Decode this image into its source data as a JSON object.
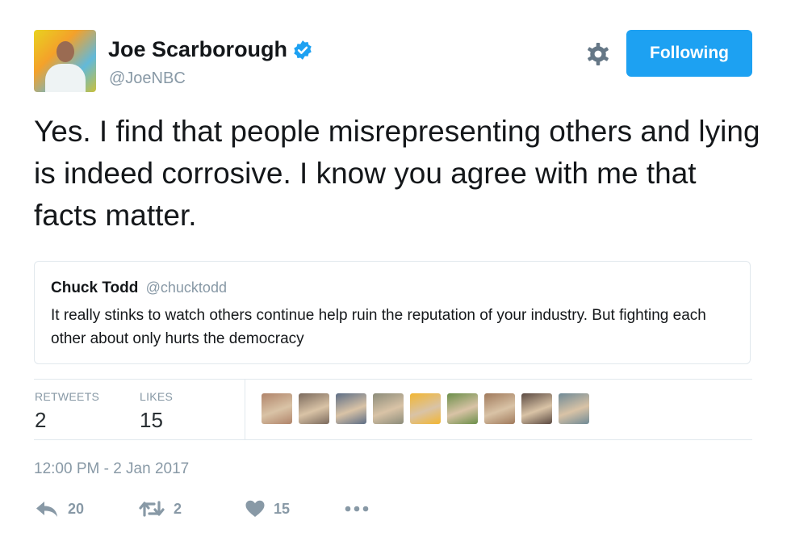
{
  "author": {
    "name": "Joe Scarborough",
    "handle": "@JoeNBC",
    "avatar_icon": "profile-photo",
    "verified_icon": "verified-badge-icon"
  },
  "header": {
    "settings_icon": "gear-icon",
    "follow_button_label": "Following"
  },
  "tweet": {
    "text": "Yes. I find that people misrepresenting others and lying is indeed corrosive. I know you agree with me that facts matter."
  },
  "quoted_tweet": {
    "author_name": "Chuck Todd",
    "author_handle": "@chucktodd",
    "text": "It really stinks to watch others continue help ruin the reputation of your industry. But fighting each other about only hurts the democracy"
  },
  "stats": {
    "retweets_label": "RETWEETS",
    "retweets_value": "2",
    "likes_label": "LIKES",
    "likes_value": "15"
  },
  "likers": [
    {
      "icon": "liker-avatar",
      "color": "#b0846a"
    },
    {
      "icon": "liker-avatar",
      "color": "#7b6a5d"
    },
    {
      "icon": "liker-avatar",
      "color": "#5d6e86"
    },
    {
      "icon": "liker-avatar",
      "color": "#8c8c7a"
    },
    {
      "icon": "liker-avatar",
      "color": "#f2b632"
    },
    {
      "icon": "liker-avatar",
      "color": "#6b8f4a"
    },
    {
      "icon": "liker-avatar",
      "color": "#a07a5c"
    },
    {
      "icon": "liker-avatar",
      "color": "#5b4a42"
    },
    {
      "icon": "liker-avatar",
      "color": "#6f8a96"
    }
  ],
  "timestamp": "12:00 PM - 2 Jan 2017",
  "actions": {
    "reply_icon": "reply-icon",
    "reply_count": "20",
    "retweet_icon": "retweet-icon",
    "retweet_count": "2",
    "like_icon": "heart-icon",
    "like_count": "15",
    "more_icon": "more-icon"
  },
  "colors": {
    "accent": "#1da1f2",
    "muted": "#8899a6",
    "text": "#14171a",
    "border": "#e1e8ed"
  }
}
